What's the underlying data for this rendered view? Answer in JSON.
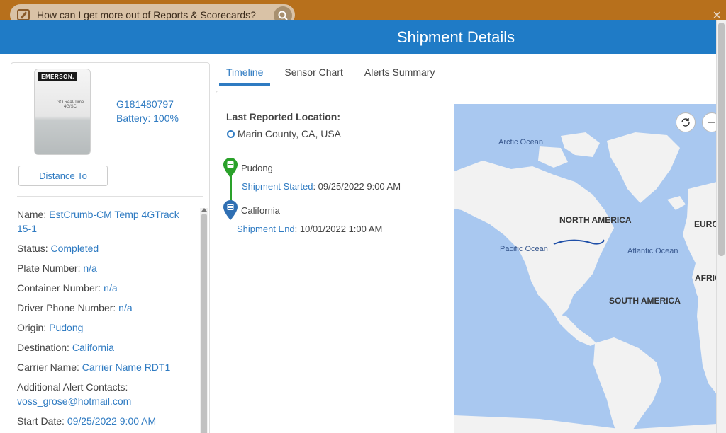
{
  "help_bar": {
    "question": "How can I get more out of Reports & Scorecards?"
  },
  "modal": {
    "title": "Shipment Details"
  },
  "device": {
    "brand": "EMERSON.",
    "model": "GO Real-Time 4G/SC",
    "id": "G181480797",
    "battery": "Battery: 100%",
    "distance_button": "Distance To"
  },
  "details": [
    {
      "key": "Name: ",
      "value": "EstCrumb-CM Temp 4GTrack 15-1"
    },
    {
      "key": "Status: ",
      "value": "Completed"
    },
    {
      "key": "Plate Number: ",
      "value": "n/a"
    },
    {
      "key": "Container Number: ",
      "value": "n/a"
    },
    {
      "key": "Driver Phone Number: ",
      "value": "n/a"
    },
    {
      "key": "Origin: ",
      "value": "Pudong"
    },
    {
      "key": "Destination: ",
      "value": "California"
    },
    {
      "key": "Carrier Name: ",
      "value": "Carrier Name RDT1"
    },
    {
      "key": "Additional Alert Contacts: ",
      "value": "voss_grose@hotmail.com"
    },
    {
      "key": "Start Date: ",
      "value": "09/25/2022 9:00 AM"
    }
  ],
  "tabs": [
    {
      "label": "Timeline",
      "active": true
    },
    {
      "label": "Sensor Chart",
      "active": false
    },
    {
      "label": "Alerts Summary",
      "active": false
    }
  ],
  "timeline": {
    "last_location_label": "Last Reported Location:",
    "last_location_value": "Marin County, CA, USA",
    "start": {
      "place": "Pudong",
      "event_label": "Shipment Started",
      "event_value": ": 09/25/2022 9:00 AM"
    },
    "end": {
      "place": "California",
      "event_label": "Shipment End",
      "event_value": ": 10/01/2022 1:00 AM"
    }
  },
  "map": {
    "labels": {
      "arctic": "Arctic Ocean",
      "north_america": "NORTH AMERICA",
      "euro": "EURO",
      "pacific": "Pacific Ocean",
      "atlantic": "Atlantic Ocean",
      "africa": "AFRIC",
      "south_america": "SOUTH AMERICA"
    },
    "colors": {
      "ocean": "#a9c8f0",
      "land": "#f2f2f2",
      "route": "#1f4fa8"
    }
  },
  "icons": {
    "edit": "edit-icon",
    "search": "search-icon",
    "close": "close-icon",
    "rotate": "rotate-icon",
    "zoom_out": "zoom-out-icon",
    "pin_start": "map-pin-start-icon",
    "pin_end": "map-pin-end-icon",
    "location_ring": "location-ring-icon"
  }
}
